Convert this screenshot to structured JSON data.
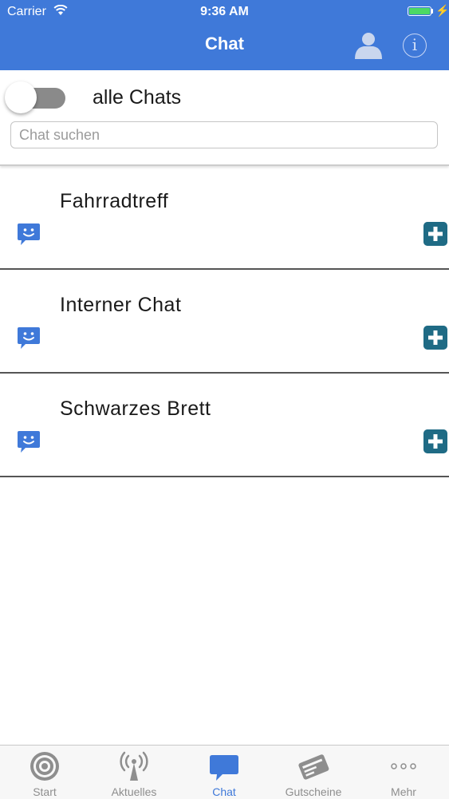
{
  "status_bar": {
    "carrier": "Carrier",
    "time": "9:36 AM"
  },
  "nav": {
    "title": "Chat",
    "user_icon": "user-icon",
    "info_icon": "info-icon",
    "info_glyph": "i"
  },
  "filter": {
    "toggle_label": "alle Chats",
    "toggle_on": false,
    "search_placeholder": "Chat suchen",
    "search_value": ""
  },
  "chats": [
    {
      "name": "Fahrradtreff"
    },
    {
      "name": "Interner Chat"
    },
    {
      "name": "Schwarzes Brett"
    }
  ],
  "tabs": [
    {
      "label": "Start",
      "icon": "target-icon",
      "active": false
    },
    {
      "label": "Aktuelles",
      "icon": "antenna-icon",
      "active": false
    },
    {
      "label": "Chat",
      "icon": "chat-bubble-icon",
      "active": true
    },
    {
      "label": "Gutscheine",
      "icon": "voucher-icon",
      "active": false
    },
    {
      "label": "Mehr",
      "icon": "more-dots-icon",
      "active": false
    }
  ],
  "colors": {
    "header": "#3f79d9",
    "chat_icon": "#3f79d9",
    "add_button": "#1f6b85",
    "tab_active": "#3f79d9",
    "tab_inactive": "#8e8e8e",
    "battery": "#4cd964"
  }
}
